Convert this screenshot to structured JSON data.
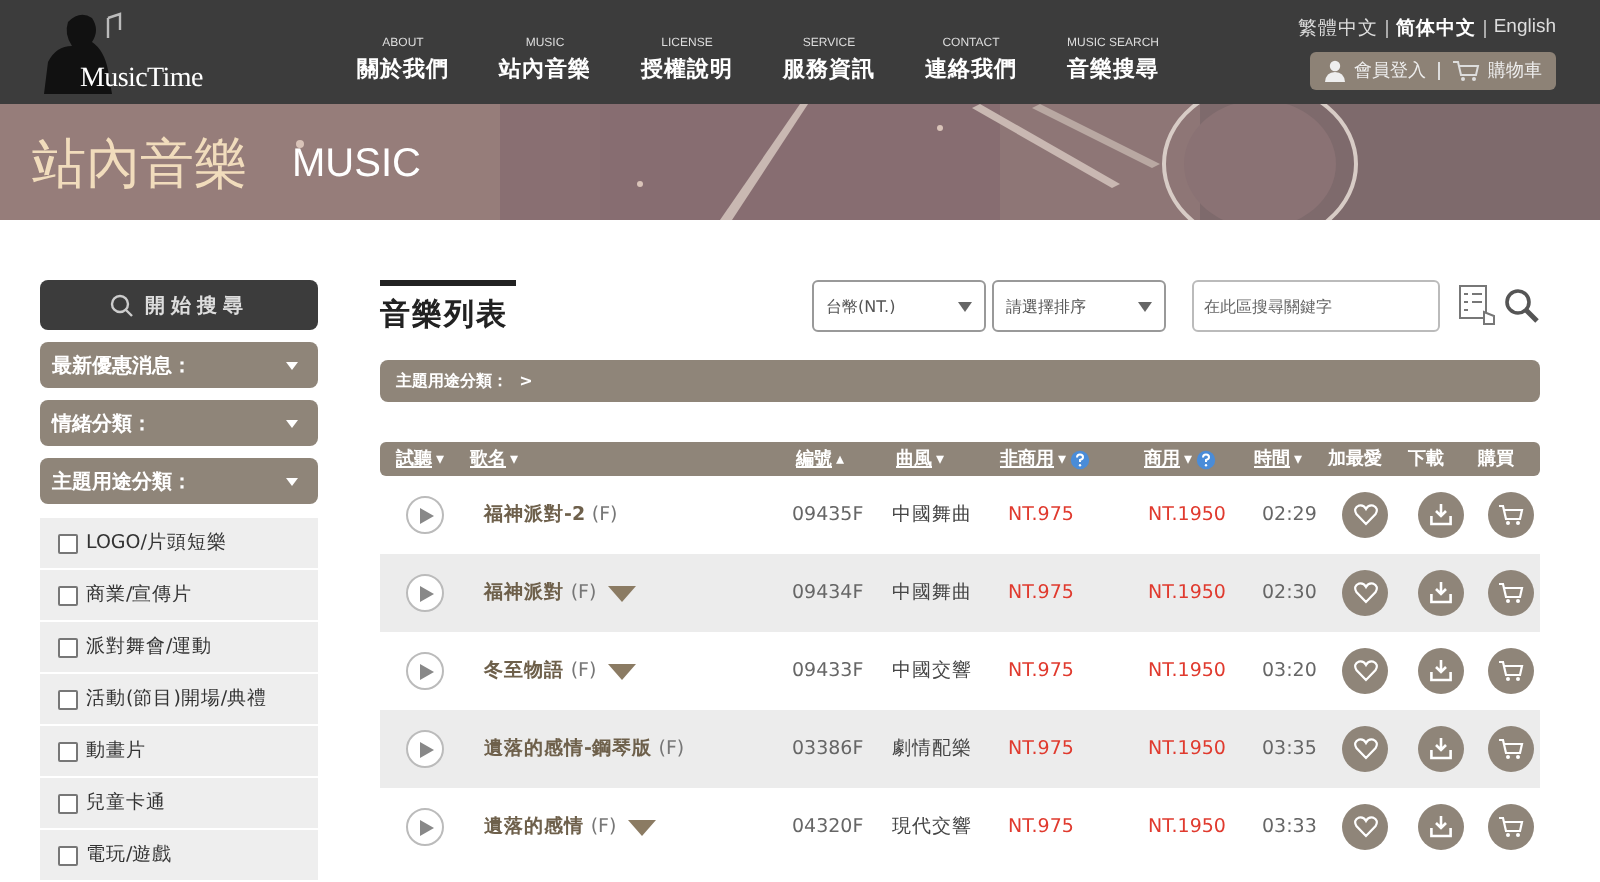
{
  "logo": {
    "text": "MusicTime"
  },
  "nav": [
    {
      "en": "ABOUT",
      "zh": "關於我們"
    },
    {
      "en": "MUSIC",
      "zh": "站內音樂"
    },
    {
      "en": "LICENSE",
      "zh": "授權說明"
    },
    {
      "en": "SERVICE",
      "zh": "服務資訊"
    },
    {
      "en": "CONTACT",
      "zh": "連絡我們"
    },
    {
      "en": "MUSIC SEARCH",
      "zh": "音樂搜尋"
    }
  ],
  "languages": [
    {
      "label": "繁體中文",
      "selected": false
    },
    {
      "label": "简体中文",
      "selected": true
    },
    {
      "label": "English",
      "selected": false
    }
  ],
  "account": {
    "login": "會員登入",
    "cart": "購物車"
  },
  "banner": {
    "title": "站內音樂",
    "subtitle": "MUSIC"
  },
  "sidebar": {
    "search_button": "開始搜尋",
    "dropdowns": [
      {
        "label": "最新優惠消息："
      },
      {
        "label": "情緒分類："
      },
      {
        "label": "主題用途分類："
      }
    ],
    "options": [
      {
        "label": "LOGO/片頭短樂",
        "checked": false
      },
      {
        "label": "商業/宣傳片",
        "checked": false
      },
      {
        "label": "派對舞會/運動",
        "checked": false
      },
      {
        "label": "活動(節目)開場/典禮",
        "checked": false
      },
      {
        "label": "動畫片",
        "checked": false
      },
      {
        "label": "兒童卡通",
        "checked": false
      },
      {
        "label": "電玩/遊戲",
        "checked": false
      }
    ]
  },
  "main": {
    "title": "音樂列表",
    "currency": "台幣(NT.)",
    "sort": "請選擇排序",
    "search": {
      "placeholder": "在此區搜尋關鍵字"
    },
    "breadcrumb": "主題用途分類：  >",
    "columns": [
      {
        "label": "試聽",
        "link": true,
        "sort_icon": "▾",
        "help": false
      },
      {
        "label": "歌名",
        "link": true,
        "sort_icon": "▾",
        "help": false
      },
      {
        "label": "編號",
        "link": true,
        "sort_icon": "▴",
        "help": false
      },
      {
        "label": "曲風",
        "link": true,
        "sort_icon": "▾",
        "help": false
      },
      {
        "label": "非商用",
        "link": true,
        "sort_icon": "▾",
        "help": true
      },
      {
        "label": "商用",
        "link": true,
        "sort_icon": "▾",
        "help": true
      },
      {
        "label": "時間",
        "link": true,
        "sort_icon": "▾",
        "help": false
      },
      {
        "label": "加最愛",
        "link": false,
        "help": false
      },
      {
        "label": "下載",
        "link": false,
        "help": false
      },
      {
        "label": "購買",
        "link": false,
        "help": false
      }
    ],
    "rows": [
      {
        "title": "福神派對-2",
        "suffix": "(F)",
        "expandable": false,
        "code": "09435F",
        "genre": "中國舞曲",
        "noncommercial": "NT.975",
        "commercial": "NT.1950",
        "time": "02:29"
      },
      {
        "title": "福神派對",
        "suffix": "(F)",
        "expandable": true,
        "code": "09434F",
        "genre": "中國舞曲",
        "noncommercial": "NT.975",
        "commercial": "NT.1950",
        "time": "02:30"
      },
      {
        "title": "冬至物語",
        "suffix": "(F)",
        "expandable": true,
        "code": "09433F",
        "genre": "中國交響",
        "noncommercial": "NT.975",
        "commercial": "NT.1950",
        "time": "03:20"
      },
      {
        "title": "遺落的感情-鋼琴版",
        "suffix": "(F)",
        "expandable": false,
        "code": "03386F",
        "genre": "劇情配樂",
        "noncommercial": "NT.975",
        "commercial": "NT.1950",
        "time": "03:35"
      },
      {
        "title": "遺落的感情",
        "suffix": "(F)",
        "expandable": true,
        "code": "04320F",
        "genre": "現代交響",
        "noncommercial": "NT.975",
        "commercial": "NT.1950",
        "time": "03:33"
      }
    ]
  }
}
